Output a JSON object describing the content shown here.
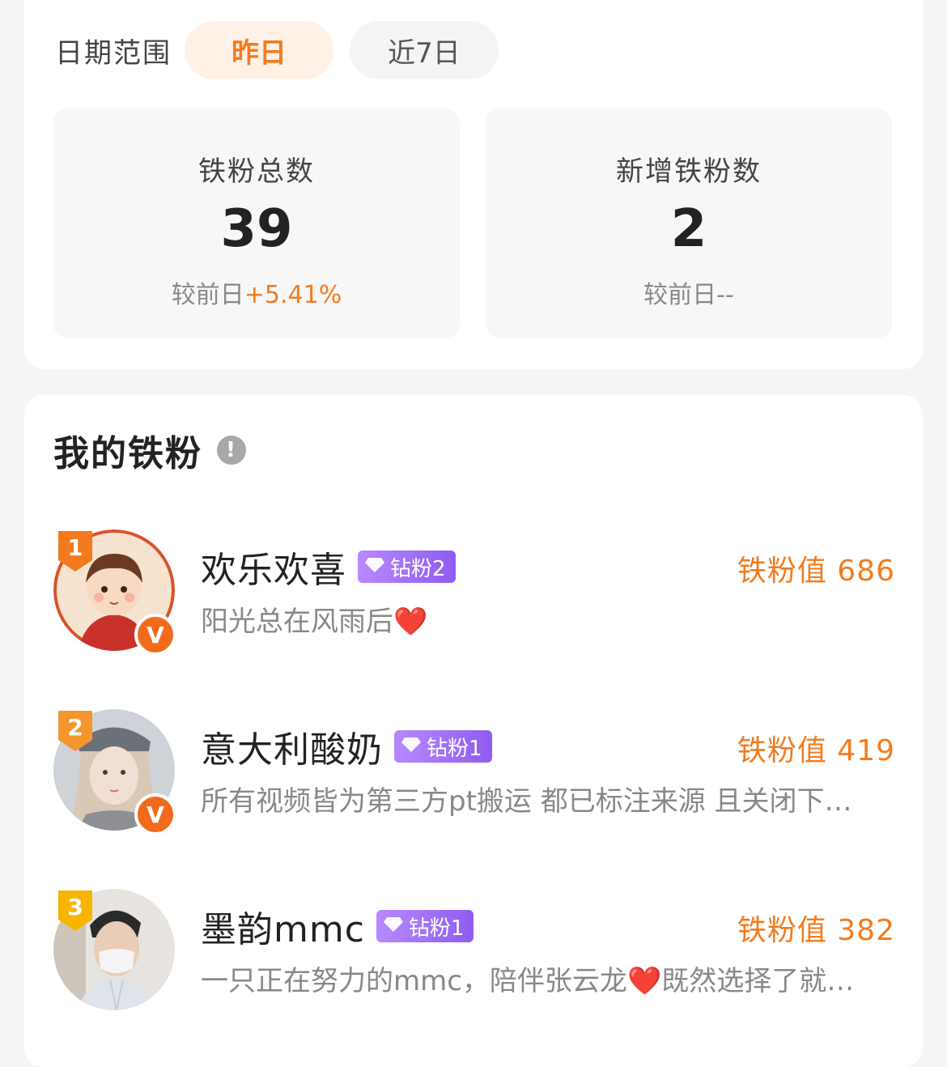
{
  "date_range": {
    "label": "日期范围",
    "options": [
      {
        "label": "昨日",
        "active": true
      },
      {
        "label": "近7日",
        "active": false
      }
    ]
  },
  "stats": [
    {
      "label": "铁粉总数",
      "value": "39",
      "compare_prefix": "较前日",
      "compare_value": "+5.41%"
    },
    {
      "label": "新增铁粉数",
      "value": "2",
      "compare_prefix": "较前日",
      "compare_value": "--"
    }
  ],
  "my_fans": {
    "title": "我的铁粉",
    "info_icon": "!",
    "items": [
      {
        "rank": "1",
        "name": "欢乐欢喜",
        "tag": "钻粉2",
        "value_label": "铁粉值 686",
        "bio": "阳光总在风雨后",
        "bio_emoji": "❤️",
        "verified": "V",
        "rank_color": "#f37b1d"
      },
      {
        "rank": "2",
        "name": "意大利酸奶",
        "tag": "钻粉1",
        "value_label": "铁粉值 419",
        "bio": "所有视频皆为第三方pt搬运 都已标注来源 且关闭下…",
        "bio_emoji": "",
        "verified": "V",
        "rank_color": "#f5952e"
      },
      {
        "rank": "3",
        "name": "墨韵mmc",
        "tag": "钻粉1",
        "value_label": "铁粉值 382",
        "bio": "一只正在努力的mmc，陪伴张云龙",
        "bio_emoji": "❤️",
        "bio_tail": "既然选择了就…",
        "verified": "",
        "rank_color": "#f7b500"
      }
    ]
  },
  "colors": {
    "accent": "#f37b1d",
    "diamond_tag": "#9b6bf2"
  }
}
